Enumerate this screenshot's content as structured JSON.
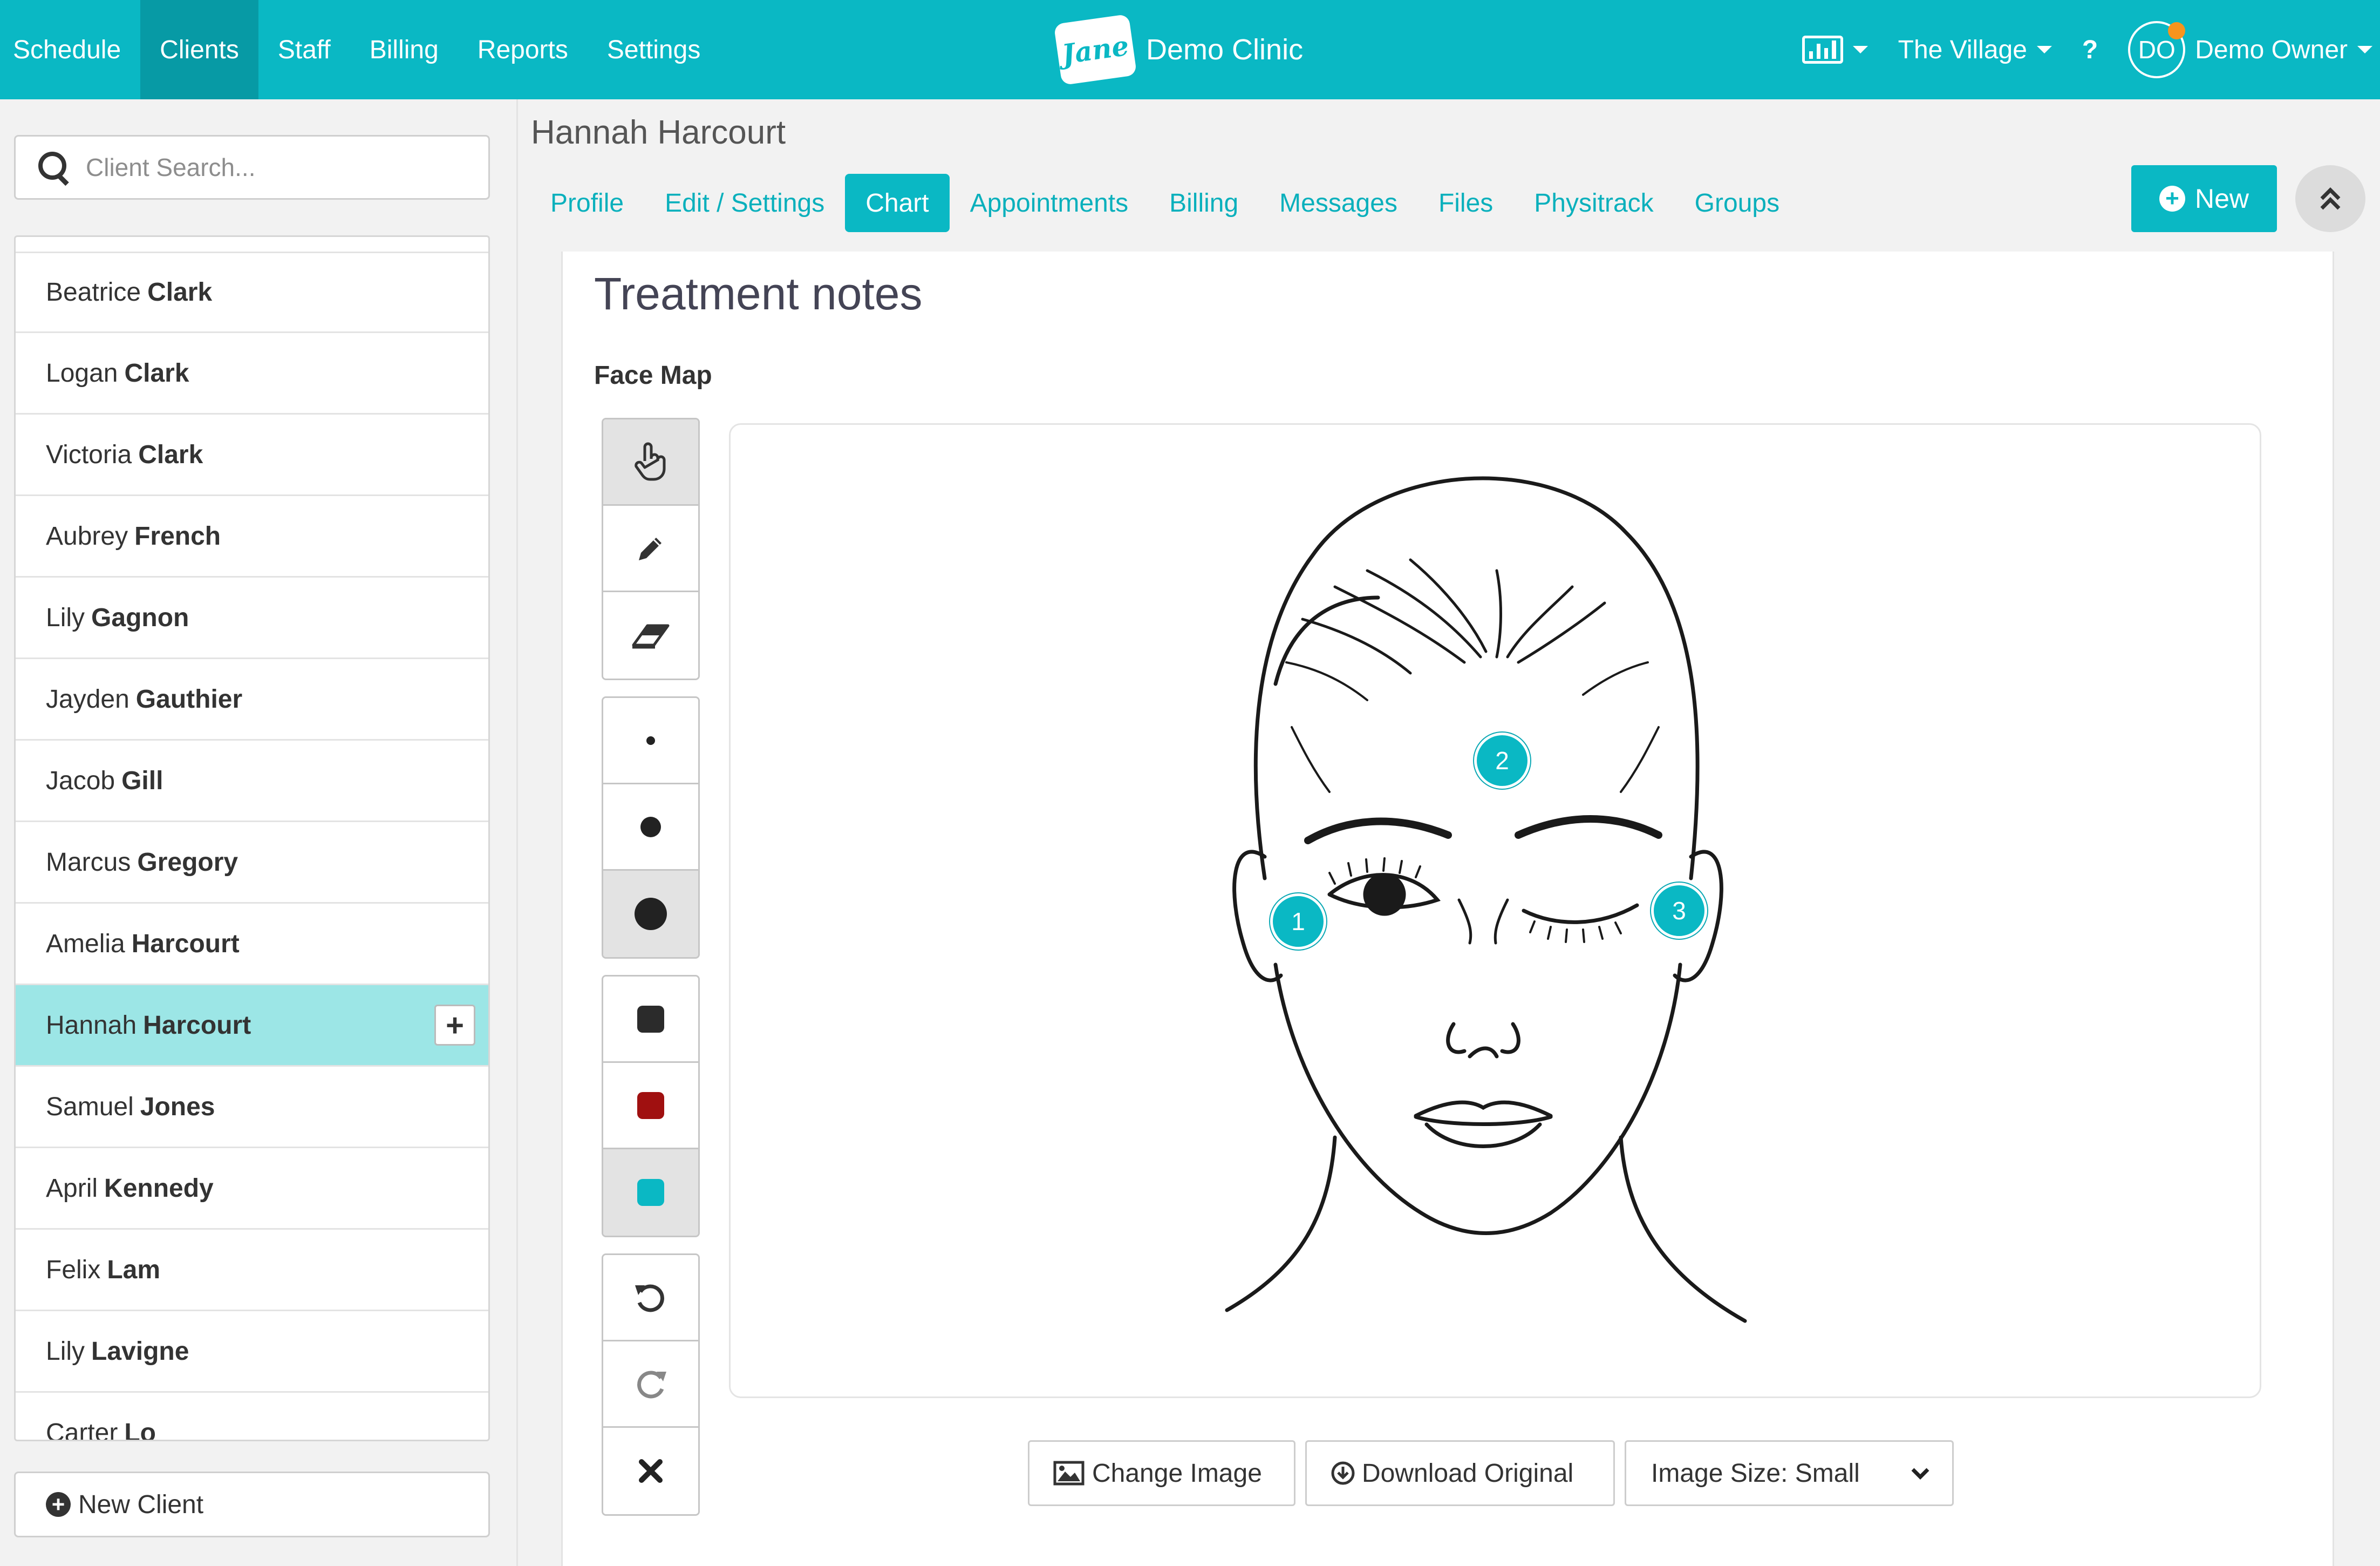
{
  "nav": {
    "items": [
      "Schedule",
      "Clients",
      "Staff",
      "Billing",
      "Reports",
      "Settings"
    ],
    "active_index": 1
  },
  "brand": {
    "logo_text": "Jane",
    "clinic_name": "Demo Clinic"
  },
  "right_nav": {
    "location": "The Village",
    "help": "?",
    "user_initials": "DO",
    "user_name": "Demo Owner"
  },
  "sidebar": {
    "search_placeholder": "Client Search...",
    "clients": [
      {
        "first": "Beatrice",
        "last": "Clark"
      },
      {
        "first": "Logan",
        "last": "Clark"
      },
      {
        "first": "Victoria",
        "last": "Clark"
      },
      {
        "first": "Aubrey",
        "last": "French"
      },
      {
        "first": "Lily",
        "last": "Gagnon"
      },
      {
        "first": "Jayden",
        "last": "Gauthier"
      },
      {
        "first": "Jacob",
        "last": "Gill"
      },
      {
        "first": "Marcus",
        "last": "Gregory"
      },
      {
        "first": "Amelia",
        "last": "Harcourt"
      },
      {
        "first": "Hannah",
        "last": "Harcourt"
      },
      {
        "first": "Samuel",
        "last": "Jones"
      },
      {
        "first": "April",
        "last": "Kennedy"
      },
      {
        "first": "Felix",
        "last": "Lam"
      },
      {
        "first": "Lily",
        "last": "Lavigne"
      },
      {
        "first": "Carter",
        "last": "Lo"
      }
    ],
    "selected_index": 9,
    "add_symbol": "+",
    "new_client_label": "New Client"
  },
  "client": {
    "name": "Hannah Harcourt",
    "tabs": [
      "Profile",
      "Edit / Settings",
      "Chart",
      "Appointments",
      "Billing",
      "Messages",
      "Files",
      "Physitrack",
      "Groups"
    ],
    "active_tab_index": 2,
    "new_button_label": "New"
  },
  "chart": {
    "title": "Treatment notes",
    "section": "Face Map",
    "tools": [
      "pointer-icon",
      "pencil-icon",
      "eraser-icon"
    ],
    "brush_sizes": [
      "small",
      "medium",
      "large"
    ],
    "colors": [
      "#2b2b2b",
      "#a01010",
      "#0ab8c4"
    ],
    "actions": [
      "undo-icon",
      "redo-icon",
      "clear-icon"
    ],
    "markers": [
      "1",
      "2",
      "3"
    ],
    "change_image_label": "Change Image",
    "download_label": "Download Original",
    "image_size_label": "Image Size: Small"
  },
  "colors": {
    "accent": "#0ab8c4",
    "accent_dark": "#079aa5",
    "selected_row": "#9ce6e6"
  }
}
